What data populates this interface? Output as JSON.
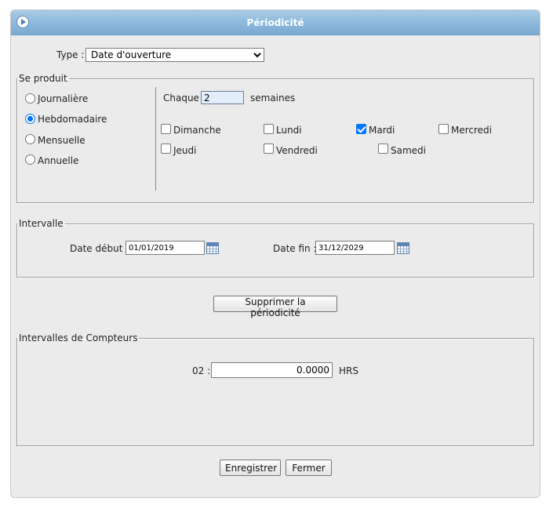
{
  "window": {
    "title": "Périodicité"
  },
  "type_field": {
    "label": "Type :",
    "selected": "Date d'ouverture"
  },
  "se_produit": {
    "legend": "Se produit",
    "frequencies": [
      {
        "label": "Journalière",
        "checked": false
      },
      {
        "label": "Hebdomadaire",
        "checked": true
      },
      {
        "label": "Mensuelle",
        "checked": false
      },
      {
        "label": "Annuelle",
        "checked": false
      }
    ],
    "every_label": "Chaque",
    "every_value": "2",
    "every_unit": "semaines",
    "days": [
      {
        "label": "Dimanche",
        "checked": false
      },
      {
        "label": "Lundi",
        "checked": false
      },
      {
        "label": "Mardi",
        "checked": true
      },
      {
        "label": "Mercredi",
        "checked": false
      },
      {
        "label": "Jeudi",
        "checked": false
      },
      {
        "label": "Vendredi",
        "checked": false
      },
      {
        "label": "Samedi",
        "checked": false
      }
    ]
  },
  "intervalle": {
    "legend": "Intervalle",
    "start_label": "Date début :",
    "start_value": "01/01/2019",
    "end_label": "Date fin :",
    "end_value": "31/12/2029"
  },
  "delete_button": "Supprimer la périodicité",
  "compteurs": {
    "legend": "Intervalles de Compteurs",
    "counter_label": "02 :",
    "counter_value": "0.0000",
    "unit": "HRS"
  },
  "footer": {
    "save": "Enregistrer",
    "close": "Fermer"
  },
  "icons": {
    "collapse": "circle-arrow-right-icon",
    "calendar": "calendar-icon",
    "dropdown": "chevron-down-icon"
  }
}
